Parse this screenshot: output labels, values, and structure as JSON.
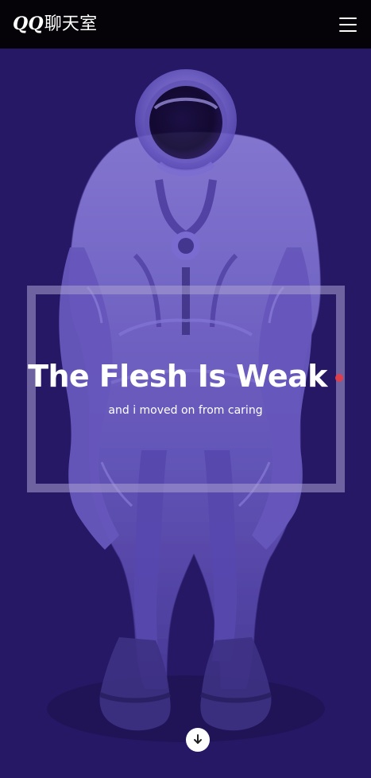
{
  "header": {
    "brand_latin": "QQ",
    "brand_cjk": "聊天室",
    "menu_icon": "hamburger-menu-icon"
  },
  "hero": {
    "background_color": "#271866",
    "title": "The Flesh Is Weak",
    "subtitle": "and i moved on from caring",
    "accent_color": "#dd3f4c",
    "image_subject": "astronaut-illustration",
    "scroll_icon": "arrow-down-icon"
  }
}
